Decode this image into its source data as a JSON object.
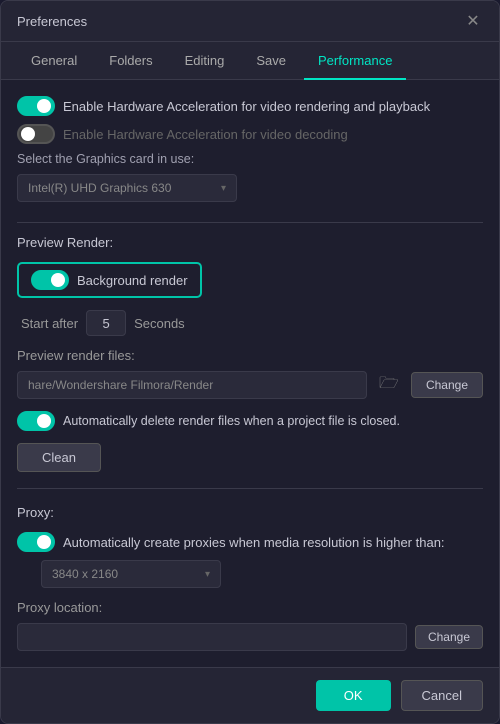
{
  "dialog": {
    "title": "Preferences"
  },
  "tabs": [
    {
      "label": "General",
      "active": false
    },
    {
      "label": "Folders",
      "active": false
    },
    {
      "label": "Editing",
      "active": false
    },
    {
      "label": "Save",
      "active": false
    },
    {
      "label": "Performance",
      "active": true
    }
  ],
  "hardware": {
    "accel_video_label": "Enable Hardware Acceleration for video rendering and playback",
    "accel_decode_label": "Enable Hardware Acceleration for video decoding",
    "graphics_label": "Select the Graphics card in use:",
    "graphics_value": "Intel(R) UHD Graphics 630"
  },
  "preview_render": {
    "section_label": "Preview Render:",
    "background_render_label": "Background render",
    "start_after_label": "Start after",
    "start_after_value": "5",
    "seconds_label": "Seconds",
    "preview_files_label": "Preview render files:",
    "file_path_value": "hare/Wondershare Filmora/Render",
    "change_label": "Change",
    "auto_delete_label": "Automatically delete render files when a project file is closed.",
    "clean_label": "Clean"
  },
  "proxy": {
    "section_label": "Proxy:",
    "auto_create_label": "Automatically create proxies when media resolution is higher than:",
    "resolution_value": "3840 x 2160",
    "location_label": "Proxy location:"
  },
  "footer": {
    "ok_label": "OK",
    "cancel_label": "Cancel"
  },
  "icons": {
    "close": "✕",
    "folder": "🗁",
    "chevron_down": "▾"
  }
}
